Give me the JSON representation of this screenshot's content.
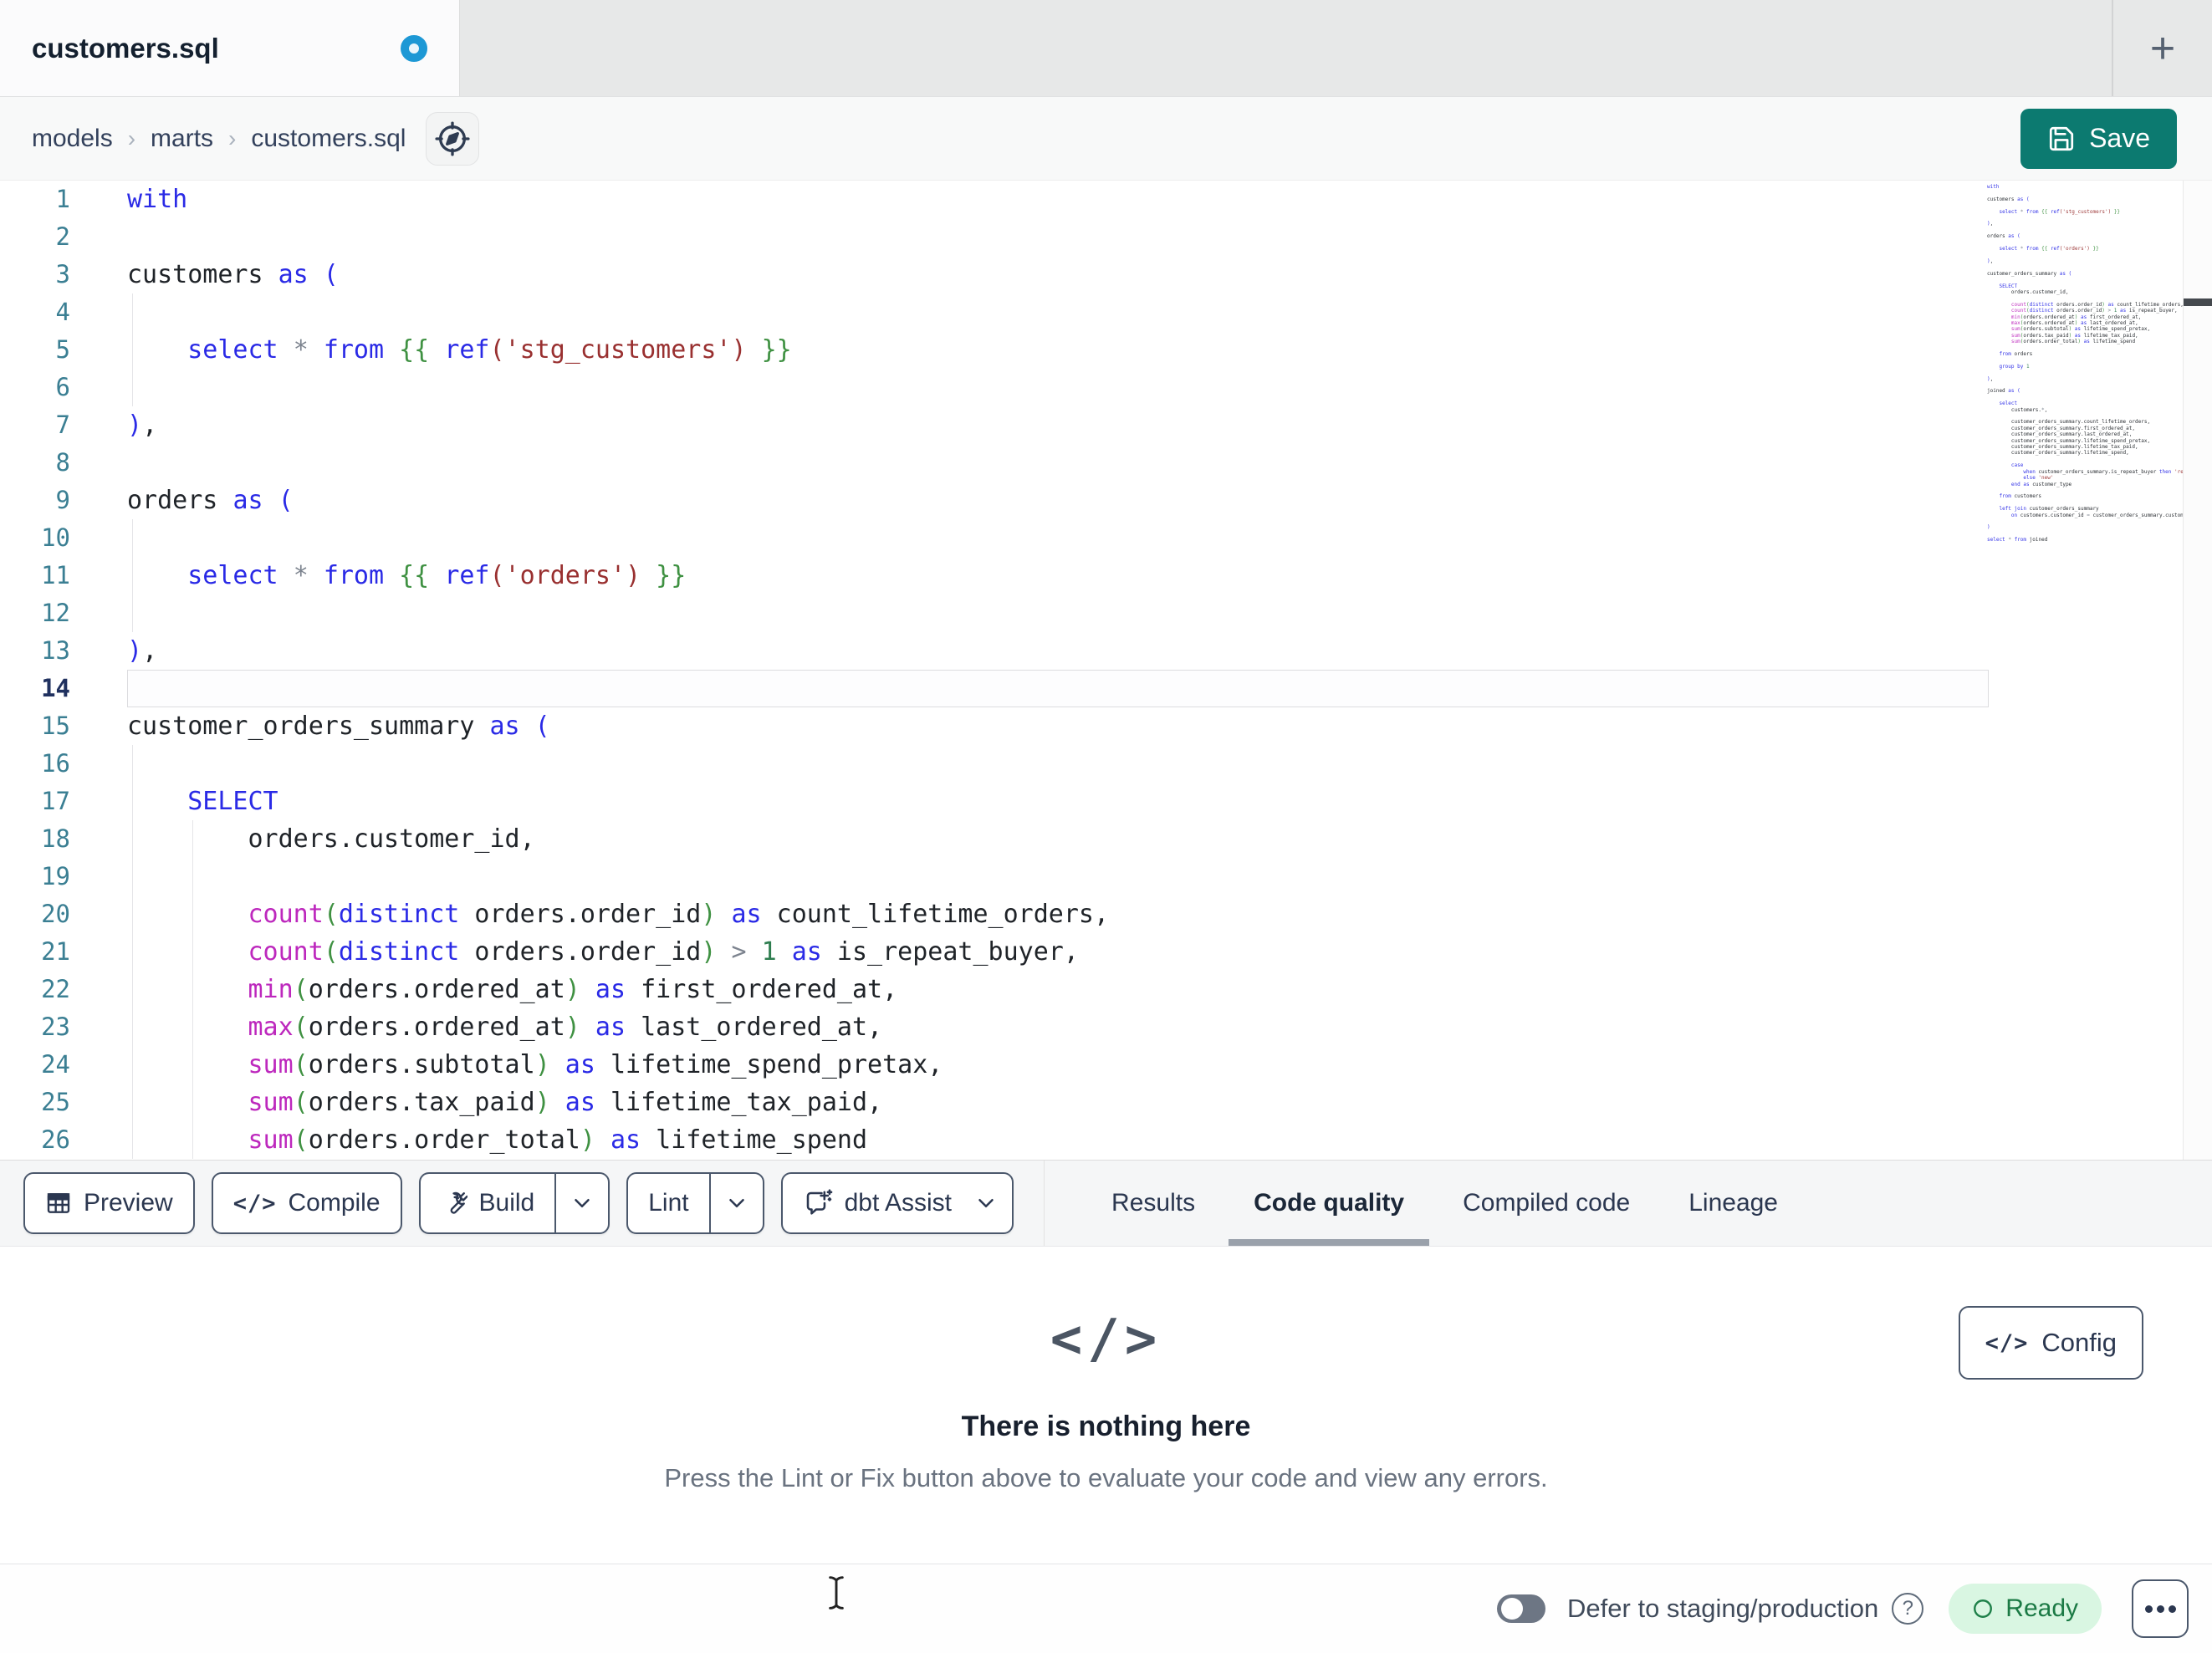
{
  "window": {
    "tab_title": "customers.sql",
    "has_unsaved_changes": true,
    "new_tab_icon": "+"
  },
  "breadcrumb": {
    "items": [
      "models",
      "marts",
      "customers.sql"
    ],
    "separator": "›"
  },
  "actions": {
    "save_label": "Save"
  },
  "editor": {
    "active_line": 14,
    "visible_line_count": 26,
    "lines": [
      [
        [
          "k",
          "with"
        ]
      ],
      [],
      [
        [
          "p",
          "customers "
        ],
        [
          "k",
          "as ("
        ]
      ],
      [],
      [
        [
          "p",
          "    "
        ],
        [
          "k",
          "select"
        ],
        [
          "p",
          " "
        ],
        [
          "o",
          "*"
        ],
        [
          "p",
          " "
        ],
        [
          "k",
          "from"
        ],
        [
          "p",
          " "
        ],
        [
          "b",
          "{{ "
        ],
        [
          "k",
          "ref"
        ],
        [
          "s",
          "('stg_customers')"
        ],
        [
          "b",
          " }}"
        ]
      ],
      [],
      [
        [
          "k",
          ")"
        ],
        [
          "p",
          ","
        ]
      ],
      [],
      [
        [
          "p",
          "orders "
        ],
        [
          "k",
          "as ("
        ]
      ],
      [],
      [
        [
          "p",
          "    "
        ],
        [
          "k",
          "select"
        ],
        [
          "p",
          " "
        ],
        [
          "o",
          "*"
        ],
        [
          "p",
          " "
        ],
        [
          "k",
          "from"
        ],
        [
          "p",
          " "
        ],
        [
          "b",
          "{{ "
        ],
        [
          "k",
          "ref"
        ],
        [
          "s",
          "('orders')"
        ],
        [
          "b",
          " }}"
        ]
      ],
      [],
      [
        [
          "k",
          ")"
        ],
        [
          "p",
          ","
        ]
      ],
      [],
      [
        [
          "p",
          "customer_orders_summary "
        ],
        [
          "k",
          "as ("
        ]
      ],
      [],
      [
        [
          "p",
          "    "
        ],
        [
          "k",
          "SELECT"
        ]
      ],
      [
        [
          "p",
          "        orders.customer_id,"
        ]
      ],
      [],
      [
        [
          "p",
          "        "
        ],
        [
          "f",
          "count"
        ],
        [
          "b",
          "("
        ],
        [
          "k",
          "distinct"
        ],
        [
          "p",
          " orders.order_id"
        ],
        [
          "b",
          ")"
        ],
        [
          "k",
          " as"
        ],
        [
          "p",
          " count_lifetime_orders,"
        ]
      ],
      [
        [
          "p",
          "        "
        ],
        [
          "f",
          "count"
        ],
        [
          "b",
          "("
        ],
        [
          "k",
          "distinct"
        ],
        [
          "p",
          " orders.order_id"
        ],
        [
          "b",
          ")"
        ],
        [
          "o",
          " >"
        ],
        [
          "n",
          " 1"
        ],
        [
          "k",
          " as"
        ],
        [
          "p",
          " is_repeat_buyer,"
        ]
      ],
      [
        [
          "p",
          "        "
        ],
        [
          "f",
          "min"
        ],
        [
          "b",
          "("
        ],
        [
          "p",
          "orders.ordered_at"
        ],
        [
          "b",
          ")"
        ],
        [
          "k",
          " as"
        ],
        [
          "p",
          " first_ordered_at,"
        ]
      ],
      [
        [
          "p",
          "        "
        ],
        [
          "f",
          "max"
        ],
        [
          "b",
          "("
        ],
        [
          "p",
          "orders.ordered_at"
        ],
        [
          "b",
          ")"
        ],
        [
          "k",
          " as"
        ],
        [
          "p",
          " last_ordered_at,"
        ]
      ],
      [
        [
          "p",
          "        "
        ],
        [
          "f",
          "sum"
        ],
        [
          "b",
          "("
        ],
        [
          "p",
          "orders.subtotal"
        ],
        [
          "b",
          ")"
        ],
        [
          "k",
          " as"
        ],
        [
          "p",
          " lifetime_spend_pretax,"
        ]
      ],
      [
        [
          "p",
          "        "
        ],
        [
          "f",
          "sum"
        ],
        [
          "b",
          "("
        ],
        [
          "p",
          "orders.tax_paid"
        ],
        [
          "b",
          ")"
        ],
        [
          "k",
          " as"
        ],
        [
          "p",
          " lifetime_tax_paid,"
        ]
      ],
      [
        [
          "p",
          "        "
        ],
        [
          "f",
          "sum"
        ],
        [
          "b",
          "("
        ],
        [
          "p",
          "orders.order_total"
        ],
        [
          "b",
          ")"
        ],
        [
          "k",
          " as"
        ],
        [
          "p",
          " lifetime_spend"
        ]
      ],
      [],
      [
        [
          "p",
          "    "
        ],
        [
          "k",
          "from"
        ],
        [
          "p",
          " orders"
        ]
      ],
      [],
      [
        [
          "p",
          "    "
        ],
        [
          "k",
          "group by"
        ],
        [
          "n",
          " 1"
        ]
      ],
      [],
      [
        [
          "k",
          ")"
        ],
        [
          "p",
          ","
        ]
      ],
      [],
      [
        [
          "p",
          "joined "
        ],
        [
          "k",
          "as ("
        ]
      ],
      [],
      [
        [
          "p",
          "    "
        ],
        [
          "k",
          "select"
        ]
      ],
      [
        [
          "p",
          "        customers."
        ],
        [
          "o",
          "*"
        ],
        [
          "p",
          ","
        ]
      ],
      [],
      [
        [
          "p",
          "        customer_orders_summary.count_lifetime_orders,"
        ]
      ],
      [
        [
          "p",
          "        customer_orders_summary.first_ordered_at,"
        ]
      ],
      [
        [
          "p",
          "        customer_orders_summary.last_ordered_at,"
        ]
      ],
      [
        [
          "p",
          "        customer_orders_summary.lifetime_spend_pretax,"
        ]
      ],
      [
        [
          "p",
          "        customer_orders_summary.lifetime_tax_paid,"
        ]
      ],
      [
        [
          "p",
          "        customer_orders_summary.lifetime_spend,"
        ]
      ],
      [],
      [
        [
          "p",
          "        "
        ],
        [
          "k",
          "case"
        ]
      ],
      [
        [
          "p",
          "            "
        ],
        [
          "k",
          "when"
        ],
        [
          "p",
          " customer_orders_summary.is_repeat_buyer "
        ],
        [
          "k",
          "then"
        ],
        [
          "s",
          " 'returning'"
        ]
      ],
      [
        [
          "p",
          "            "
        ],
        [
          "k",
          "else"
        ],
        [
          "s",
          " 'new'"
        ]
      ],
      [
        [
          "p",
          "        "
        ],
        [
          "k",
          "end as"
        ],
        [
          "p",
          " customer_type"
        ]
      ],
      [],
      [
        [
          "p",
          "    "
        ],
        [
          "k",
          "from"
        ],
        [
          "p",
          " customers"
        ]
      ],
      [],
      [
        [
          "p",
          "    "
        ],
        [
          "k",
          "left join"
        ],
        [
          "p",
          " customer_orders_summary"
        ]
      ],
      [
        [
          "p",
          "        "
        ],
        [
          "k",
          "on"
        ],
        [
          "p",
          " customers.customer_id "
        ],
        [
          "o",
          "="
        ],
        [
          "p",
          " customer_orders_summary.customer_id"
        ]
      ],
      [],
      [
        [
          "k",
          ")"
        ]
      ],
      [],
      [
        [
          "k",
          "select"
        ],
        [
          "p",
          " "
        ],
        [
          "o",
          "*"
        ],
        [
          "p",
          " "
        ],
        [
          "k",
          "from"
        ],
        [
          "p",
          " joined"
        ]
      ]
    ]
  },
  "toolbar": {
    "preview_label": "Preview",
    "compile_label": "Compile",
    "build_label": "Build",
    "lint_label": "Lint",
    "dbt_assist_label": "dbt Assist",
    "compile_icon_glyph": "</>"
  },
  "result_tabs": [
    {
      "label": "Results",
      "active": false
    },
    {
      "label": "Code quality",
      "active": true
    },
    {
      "label": "Compiled code",
      "active": false
    },
    {
      "label": "Lineage",
      "active": false
    }
  ],
  "panel": {
    "empty_state_icon": "</>",
    "title": "There is nothing here",
    "subtitle": "Press the Lint or Fix button above to evaluate your code and view any errors.",
    "config_label": "Config",
    "config_icon_glyph": "</>"
  },
  "status_bar": {
    "defer_toggle_on": false,
    "defer_label": "Defer to staging/production",
    "help_icon": "?",
    "ready_label": "Ready"
  },
  "colors": {
    "accent_teal": "#0c7a70",
    "keyword": "#2a2ae6",
    "function": "#bd28bd",
    "string": "#993030",
    "bracket_green": "#3f9142",
    "number": "#2e7d4f",
    "operator": "#7d848f",
    "line_number": "#3b7f93",
    "active_line_number": "#20315f",
    "unsaved_indicator_blue": "#1d98d5",
    "ready_bg": "#d9f6e2",
    "ready_text": "#1b7a45",
    "tab_underline": "#9aa1ab"
  }
}
